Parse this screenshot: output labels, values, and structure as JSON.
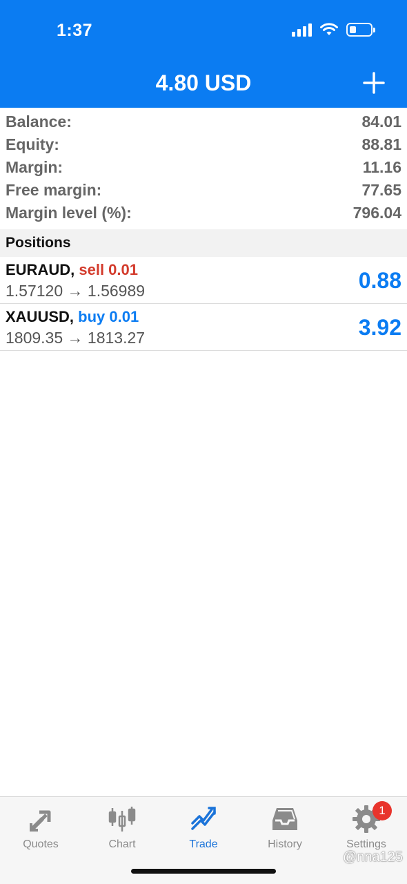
{
  "status_bar": {
    "time": "1:37"
  },
  "header": {
    "title": "4.80 USD"
  },
  "summary": [
    {
      "label": "Balance:",
      "value": "84.01"
    },
    {
      "label": "Equity:",
      "value": "88.81"
    },
    {
      "label": "Margin:",
      "value": "11.16"
    },
    {
      "label": "Free margin:",
      "value": "77.65"
    },
    {
      "label": "Margin level (%):",
      "value": "796.04"
    }
  ],
  "positions": {
    "heading": "Positions",
    "items": [
      {
        "symbol": "EURAUD,",
        "side": "sell 0.01",
        "prices": "1.57120 → 1.56989",
        "profit": "0.88"
      },
      {
        "symbol": "XAUUSD,",
        "side": "buy 0.01",
        "prices": "1809.35 → 1813.27",
        "profit": "3.92"
      }
    ]
  },
  "tabs": [
    {
      "label": "Quotes",
      "icon": "quotes-arrows-icon"
    },
    {
      "label": "Chart",
      "icon": "candlestick-icon"
    },
    {
      "label": "Trade",
      "icon": "trade-trend-icon",
      "active": true
    },
    {
      "label": "History",
      "icon": "inbox-tray-icon"
    },
    {
      "label": "Settings",
      "icon": "gear-icon",
      "badge": "1"
    }
  ],
  "watermark": "@nna125",
  "colors": {
    "header": "#0b7cf2",
    "sell": "#d33b2c",
    "buy": "#0b7cf2",
    "badge": "#e8342c"
  }
}
